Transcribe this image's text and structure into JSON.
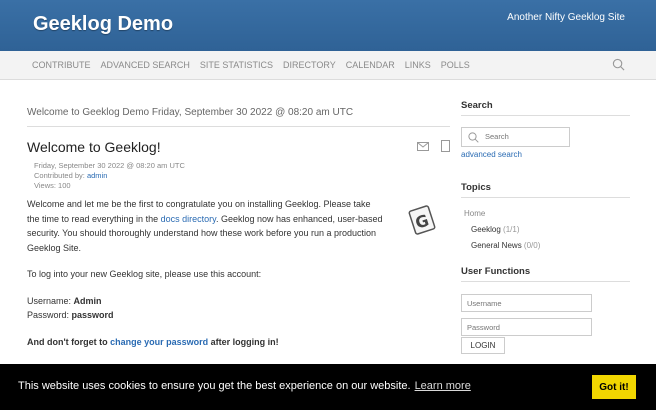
{
  "header": {
    "site_name": "Geeklog Demo",
    "slogan": "Another Nifty Geeklog Site"
  },
  "nav": {
    "items": [
      "CONTRIBUTE",
      "ADVANCED SEARCH",
      "SITE STATISTICS",
      "DIRECTORY",
      "CALENDAR",
      "LINKS",
      "POLLS"
    ],
    "search_icon": "search-icon"
  },
  "main": {
    "welcome": "Welcome to Geeklog Demo Friday, September 30 2022 @ 08:20 am UTC",
    "article": {
      "title": "Welcome to Geeklog!",
      "date": "Friday, September 30 2022 @ 08:20 am UTC",
      "contributed_prefix": "Contributed by: ",
      "author": "admin",
      "views": "Views: 100",
      "p1_a": "Welcome and let me be the first to congratulate you on installing Geeklog. Please take the time to read everything in the ",
      "p1_link": "docs directory",
      "p1_b": ". Geeklog now has enhanced, user-based security. You should thoroughly understand how these work before you run a production Geeklog Site.",
      "p2": "To log into your new Geeklog site, please use this account:",
      "username_label": "Username: ",
      "username": "Admin",
      "password_label": "Password: ",
      "password": "password",
      "p4_a": "And don't forget to ",
      "p4_link": "change your password",
      "p4_b": " after logging in!"
    }
  },
  "sidebar": {
    "search": {
      "title": "Search",
      "placeholder": "Search",
      "advanced": "advanced search"
    },
    "topics": {
      "title": "Topics",
      "home": "Home",
      "items": [
        {
          "name": "Geeklog",
          "count": "(1/1)"
        },
        {
          "name": "General News",
          "count": "(0/0)"
        }
      ]
    },
    "user_functions": {
      "title": "User Functions",
      "username_placeholder": "Username",
      "password_placeholder": "Password",
      "login": "LOGIN"
    }
  },
  "cookie": {
    "message": "This website uses cookies to ensure you get the best experience on our website.",
    "learn_more": "Learn more",
    "button": "Got it!"
  },
  "colors": {
    "header": "#3a70a6",
    "link": "#2a6bb3",
    "cookie_bar": "#000000",
    "cookie_button": "#f1d600"
  }
}
